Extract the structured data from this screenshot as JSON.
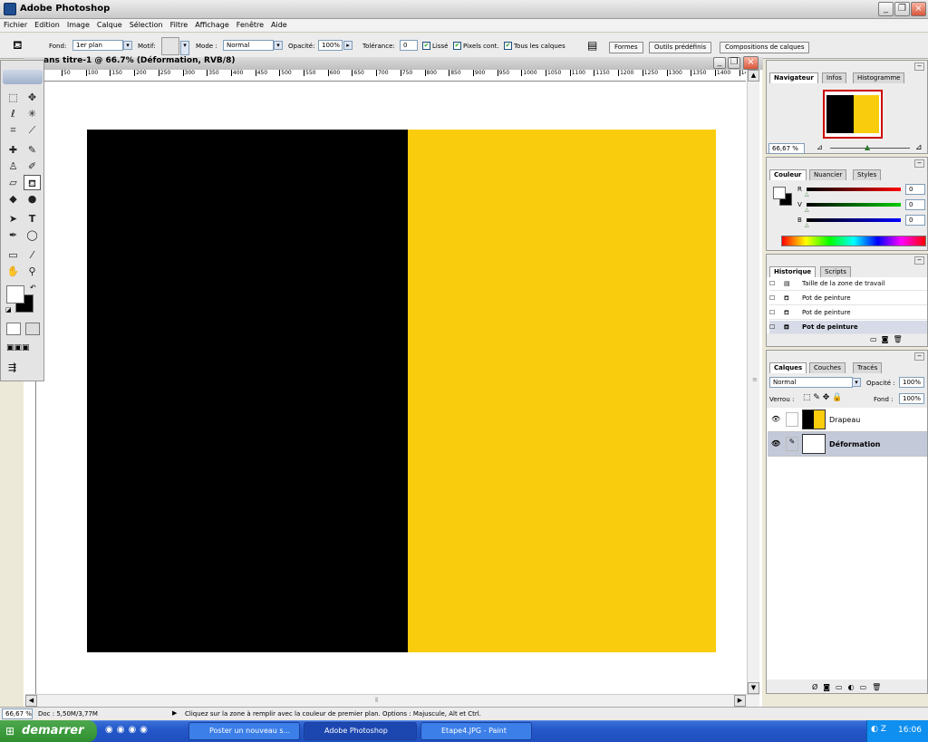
{
  "window": {
    "title": "Adobe Photoshop"
  },
  "menu": [
    "Fichier",
    "Edition",
    "Image",
    "Calque",
    "Sélection",
    "Filtre",
    "Affichage",
    "Fenêtre",
    "Aide"
  ],
  "options": {
    "fond_label": "Fond:",
    "fond_value": "1er plan",
    "motif_label": "Motif:",
    "mode_label": "Mode :",
    "mode_value": "Normal",
    "opacity_label": "Opacité:",
    "opacity_value": "100%",
    "tolerance_label": "Tolérance:",
    "tolerance_value": "0",
    "lisse": "Lissé",
    "pixels_cont": "Pixels cont.",
    "tous_calques": "Tous les calques",
    "wells": [
      "Formes",
      "Outils prédéfinis",
      "Compositions de calques"
    ]
  },
  "document": {
    "title": "ans titre-1 @ 66.7% (Déformation, RVB/8)",
    "ruler_ticks": [
      "50",
      "100",
      "150",
      "200",
      "250",
      "300",
      "350",
      "400",
      "450",
      "500",
      "550",
      "600",
      "650",
      "700",
      "750",
      "800",
      "850",
      "900",
      "950",
      "1000",
      "1050",
      "1100",
      "1150",
      "1200",
      "1250",
      "1300",
      "1350",
      "1400",
      "14"
    ]
  },
  "navigator": {
    "tabs": [
      "Navigateur",
      "Infos",
      "Histogramme"
    ],
    "zoom": "66,67 %"
  },
  "color": {
    "tabs": [
      "Couleur",
      "Nuancier",
      "Styles"
    ],
    "channels": [
      {
        "label": "R",
        "value": "0"
      },
      {
        "label": "V",
        "value": "0"
      },
      {
        "label": "B",
        "value": "0"
      }
    ]
  },
  "history": {
    "tabs": [
      "Historique",
      "Scripts"
    ],
    "items": [
      "Taille de la zone de travail",
      "Pot de peinture",
      "Pot de peinture",
      "Pot de peinture"
    ]
  },
  "layers": {
    "tabs": [
      "Calques",
      "Couches",
      "Tracés"
    ],
    "blend": "Normal",
    "opacity_label": "Opacité :",
    "opacity_value": "100%",
    "lock_label": "Verrou :",
    "fill_label": "Fond :",
    "fill_value": "100%",
    "items": [
      {
        "name": "Drapeau"
      },
      {
        "name": "Déformation"
      }
    ]
  },
  "status": {
    "zoom": "66,67 %",
    "doc": "Doc : 5,50M/3,77M",
    "hint": "Cliquez sur la zone à remplir avec la couleur de premier plan. Options : Majuscule, Alt et Ctrl."
  },
  "taskbar": {
    "start": "demarrer",
    "tasks": [
      "Poster un nouveau s...",
      "Adobe Photoshop",
      "Etape4.JPG - Paint"
    ],
    "clock": "16:06"
  },
  "colors": {
    "flag_left": "#000000",
    "flag_right": "#f9cc0d"
  }
}
